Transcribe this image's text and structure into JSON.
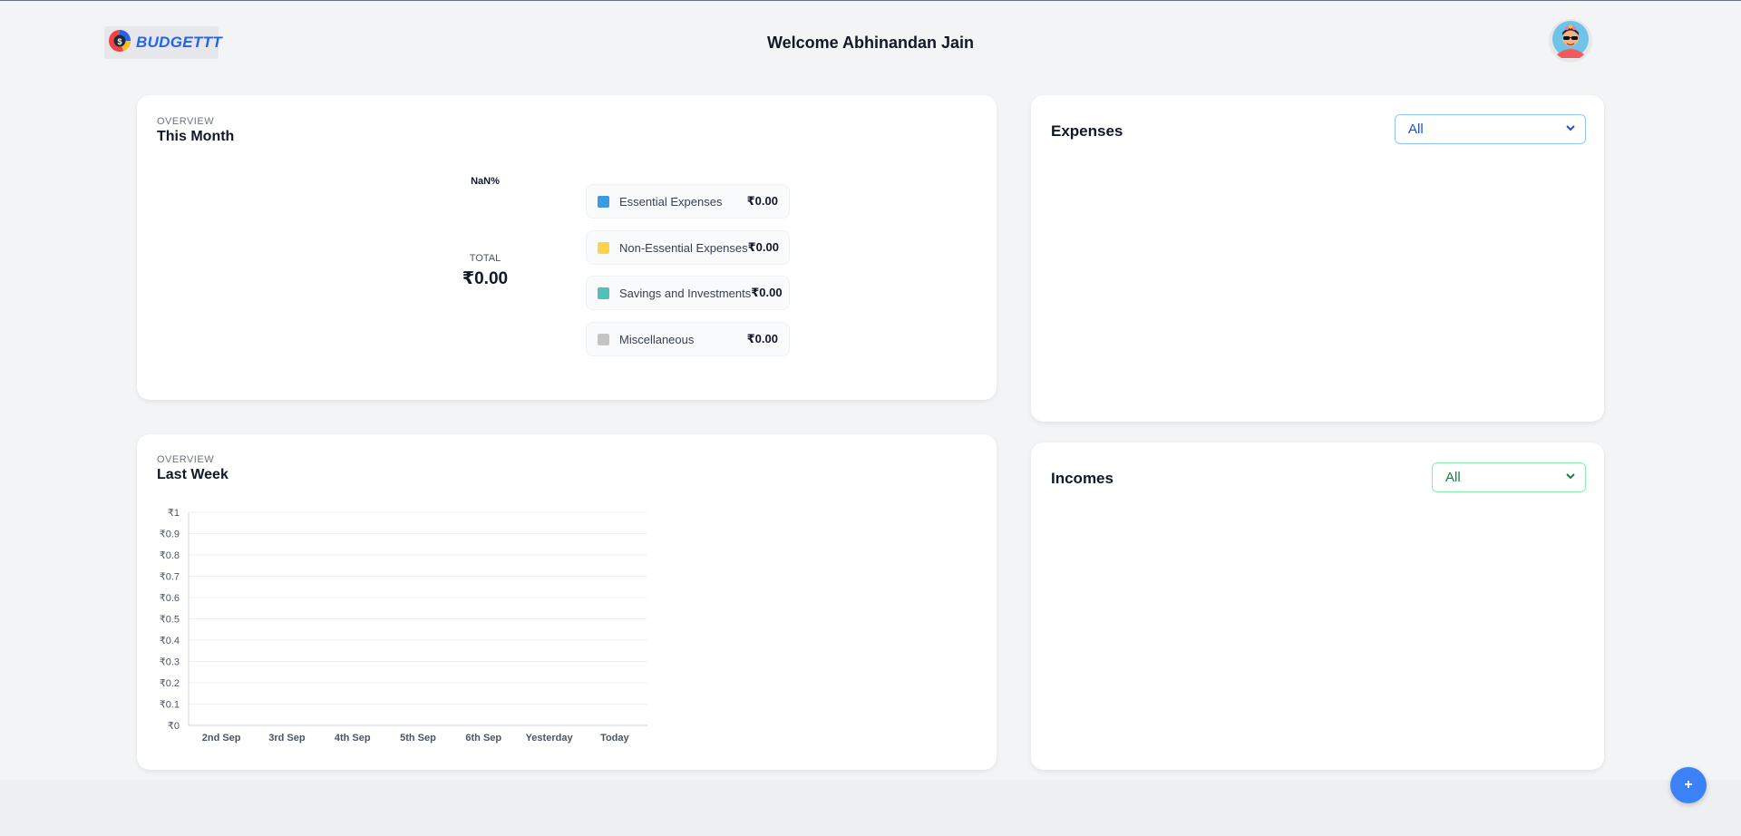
{
  "header": {
    "logo_text": "BUDGETTT",
    "welcome": "Welcome Abhinandan Jain"
  },
  "overview_month": {
    "eyebrow": "OVERVIEW",
    "title": "This Month",
    "percent": "NaN%",
    "total_label": "TOTAL",
    "total_value": "₹0.00",
    "legend": [
      {
        "label": "Essential Expenses",
        "value": "₹0.00",
        "color": "#3b9ae1"
      },
      {
        "label": "Non-Essential Expenses",
        "value": "₹0.00",
        "color": "#fcd34d"
      },
      {
        "label": "Savings and Investments",
        "value": "₹0.00",
        "color": "#4fc1b6"
      },
      {
        "label": "Miscellaneous",
        "value": "₹0.00",
        "color": "#c4c4c4"
      }
    ]
  },
  "overview_week": {
    "eyebrow": "OVERVIEW",
    "title": "Last Week"
  },
  "expenses": {
    "title": "Expenses",
    "filter_value": "All"
  },
  "incomes": {
    "title": "Incomes",
    "filter_value": "All"
  },
  "fab": {
    "label": "+"
  },
  "chart_data": {
    "type": "bar",
    "title": "",
    "xlabel": "",
    "ylabel": "",
    "categories": [
      "2nd Sep",
      "3rd Sep",
      "4th Sep",
      "5th Sep",
      "6th Sep",
      "Yesterday",
      "Today"
    ],
    "values": [
      0,
      0,
      0,
      0,
      0,
      0,
      0
    ],
    "ylim": [
      0,
      1
    ],
    "y_ticks": [
      "₹0",
      "₹0.1",
      "₹0.2",
      "₹0.3",
      "₹0.4",
      "₹0.5",
      "₹0.6",
      "₹0.7",
      "₹0.8",
      "₹0.9",
      "₹1"
    ],
    "grid": true
  }
}
